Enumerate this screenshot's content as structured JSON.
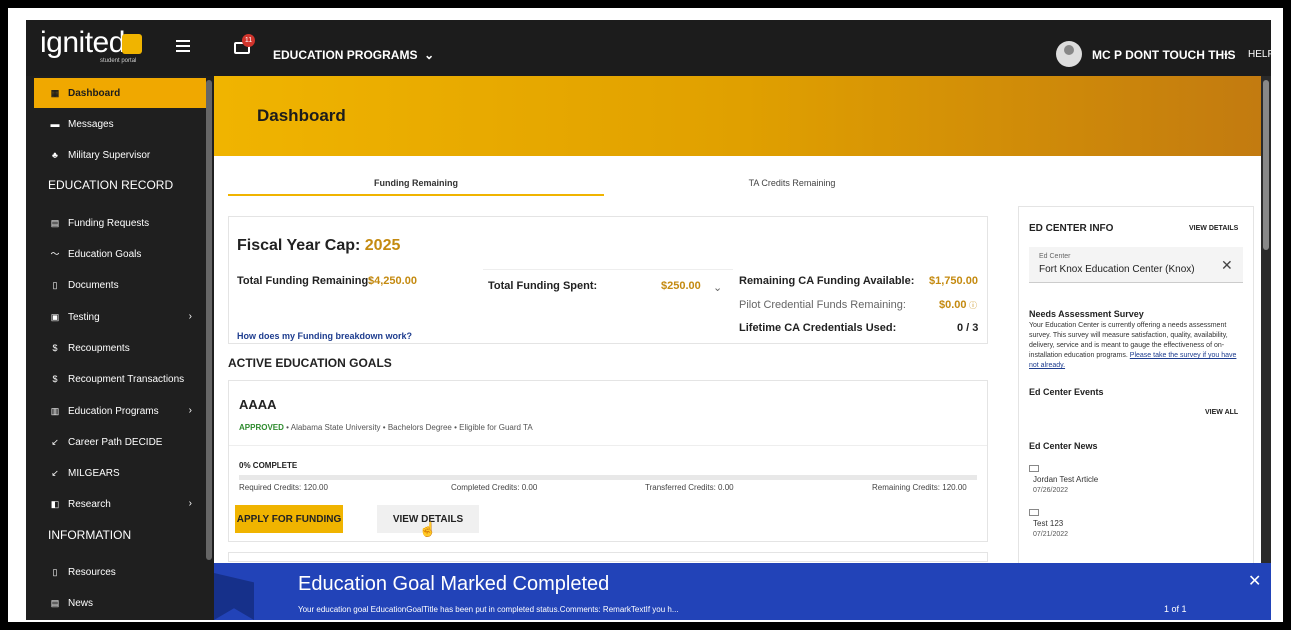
{
  "topbar": {
    "logo": "ignited",
    "logo_sub": "student portal",
    "mail_badge": "11",
    "programs_menu": "EDUCATION PROGRAMS",
    "user_name": "MC P DONT TOUCH THIS",
    "help": "HELP"
  },
  "sidebar": {
    "items": [
      {
        "label": "Dashboard",
        "icon": "dashboard-icon"
      },
      {
        "label": "Messages",
        "icon": "message-icon"
      },
      {
        "label": "Military Supervisor",
        "icon": "supervisor-icon"
      },
      {
        "label": "Funding Requests",
        "icon": "funding-icon"
      },
      {
        "label": "Education Goals",
        "icon": "goals-icon"
      },
      {
        "label": "Documents",
        "icon": "document-icon"
      },
      {
        "label": "Testing",
        "icon": "testing-icon"
      },
      {
        "label": "Recoupments",
        "icon": "dollar-icon"
      },
      {
        "label": "Recoupment Transactions",
        "icon": "dollar-icon"
      },
      {
        "label": "Education Programs",
        "icon": "programs-icon"
      },
      {
        "label": "Career Path DECIDE",
        "icon": "career-icon"
      },
      {
        "label": "MILGEARS",
        "icon": "milgears-icon"
      },
      {
        "label": "Research",
        "icon": "research-icon"
      },
      {
        "label": "Resources",
        "icon": "resources-icon"
      },
      {
        "label": "News",
        "icon": "news-icon"
      }
    ],
    "section_education": "EDUCATION RECORD",
    "section_information": "INFORMATION"
  },
  "header": {
    "title": "Dashboard"
  },
  "tabs": {
    "funding": "Funding Remaining",
    "ta": "TA Credits Remaining"
  },
  "funding": {
    "fy_label": "Fiscal Year Cap:",
    "fy_year": "2025",
    "total_remaining_label": "Total Funding Remaining:",
    "total_remaining_value": "$4,250.00",
    "total_spent_label": "Total Funding Spent:",
    "total_spent_value": "$250.00",
    "ca_available_label": "Remaining CA Funding Available:",
    "ca_available_value": "$1,750.00",
    "pilot_label": "Pilot Credential Funds Remaining:",
    "pilot_value": "$0.00",
    "lifetime_label": "Lifetime CA Credentials Used:",
    "lifetime_value": "0 / 3",
    "breakdown_link": "How does my Funding breakdown work?"
  },
  "goals": {
    "heading": "ACTIVE EDUCATION GOALS",
    "card": {
      "title": "AAAA",
      "status": "APPROVED",
      "school": "Alabama State University",
      "degree": "Bachelors Degree",
      "eligibility": "Eligible for Guard TA",
      "progress_label": "0% COMPLETE",
      "progress": 0,
      "required": "Required Credits: 120.00",
      "completed": "Completed Credits: 0.00",
      "transferred": "Transferred Credits: 0.00",
      "remaining": "Remaining Credits: 120.00",
      "apply_button": "APPLY FOR FUNDING",
      "details_button": "VIEW DETAILS"
    }
  },
  "edcenter": {
    "title": "ED CENTER INFO",
    "view_details": "VIEW DETAILS",
    "field_label": "Ed Center",
    "field_value": "Fort Knox Education Center (Knox)",
    "survey_title": "Needs Assessment Survey",
    "survey_text": "Your Education Center is currently offering a needs assessment survey. This survey will measure satisfaction, quality, availability, delivery, service and is meant to gauge the effectiveness of on-installation education programs.",
    "survey_link": "Please take the survey if you have not already.",
    "events_title": "Ed Center Events",
    "events_view_all": "VIEW ALL",
    "news_title": "Ed Center News",
    "news": [
      {
        "title": "Jordan Test Article",
        "date": "07/26/2022"
      },
      {
        "title": "Test 123",
        "date": "07/21/2022"
      }
    ]
  },
  "toast": {
    "title": "Education Goal Marked Completed",
    "body": "Your education goal EducationGoalTitle has been put in completed status.Comments: RemarkTextIf you h...",
    "pager": "1 of 1"
  },
  "colors": {
    "accent": "#f0b400",
    "sidebar": "#1f1f1f",
    "toast": "#2243b8",
    "approved": "#2e8b2e"
  }
}
